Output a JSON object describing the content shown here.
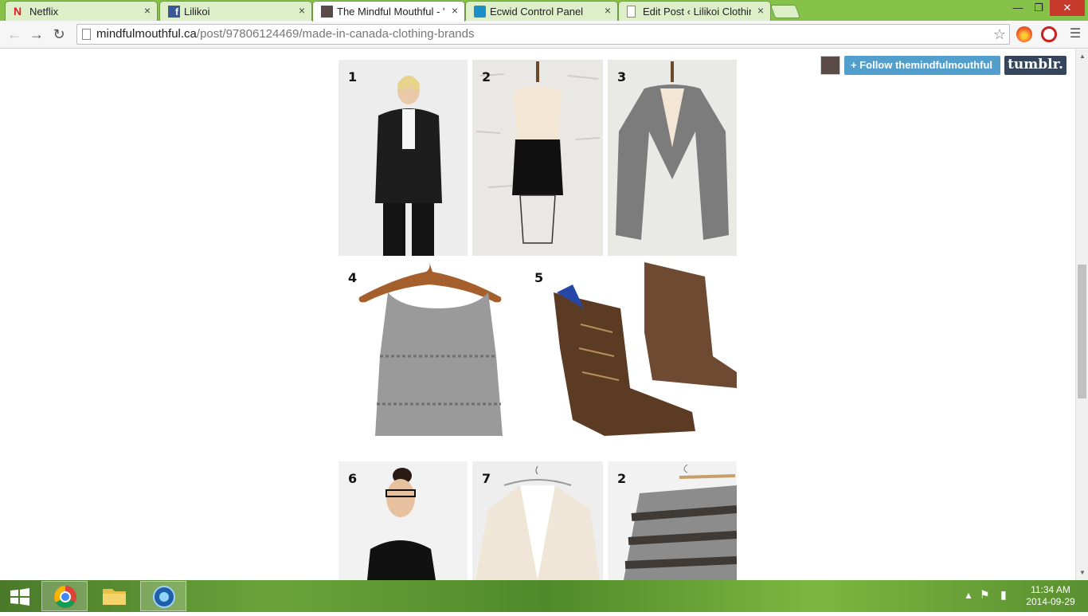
{
  "browser": {
    "tabs": [
      {
        "label": "Netflix",
        "icon": "netflix-icon",
        "active": false
      },
      {
        "label": "Lilikoi",
        "icon": "facebook-icon",
        "active": false
      },
      {
        "label": "The Mindful Mouthful - \"I",
        "icon": "tumblr-avatar-icon",
        "active": true
      },
      {
        "label": "Ecwid Control Panel",
        "icon": "ecwid-icon",
        "active": false
      },
      {
        "label": "Edit Post ‹ Lilikoi Clothing",
        "icon": "page-icon",
        "active": false
      }
    ],
    "url_domain": "mindfulmouthful.ca",
    "url_path": "/post/97806124469/made-in-canada-clothing-brands",
    "tab_close_glyph": "×"
  },
  "page": {
    "follow_button": "+ Follow themindfulmouthful",
    "tumblr_logo": "tumblr.",
    "images": [
      {
        "num": "1",
        "icon": "black-blazer-outfit-photo"
      },
      {
        "num": "2",
        "icon": "pencil-skirt-photo"
      },
      {
        "num": "3",
        "icon": "grey-cardigan-photo"
      },
      {
        "num": "4",
        "icon": "knit-crop-top-photo"
      },
      {
        "num": "5",
        "icon": "leather-boots-photo"
      },
      {
        "num": "6",
        "icon": "black-top-model-photo"
      },
      {
        "num": "7",
        "icon": "cream-knit-cardigan-photo"
      },
      {
        "num": "2",
        "icon": "striped-sweater-photo"
      }
    ]
  },
  "taskbar": {
    "time": "11:34 AM",
    "date": "2014-09-29"
  }
}
